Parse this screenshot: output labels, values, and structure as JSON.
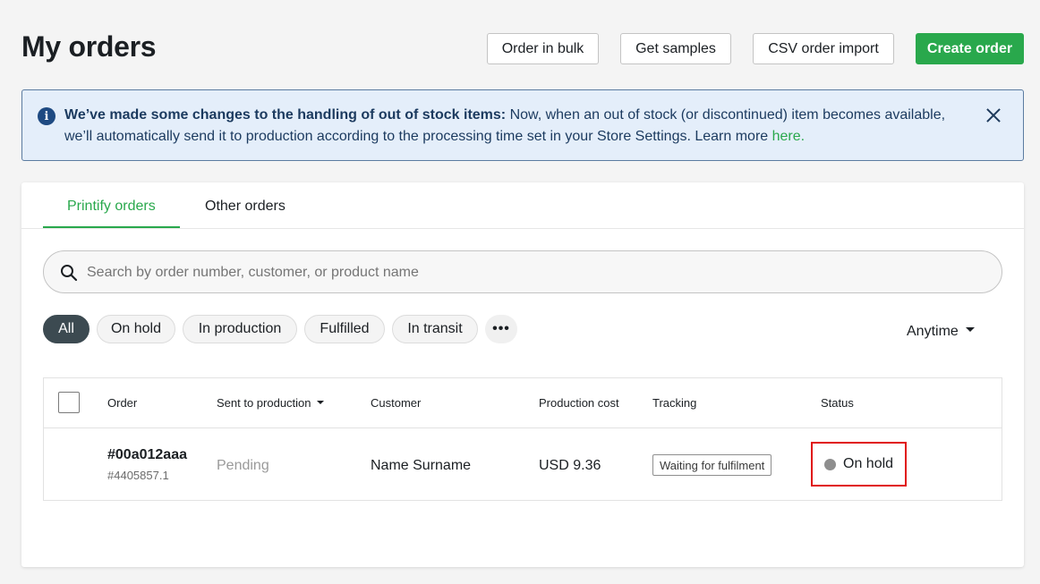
{
  "page": {
    "title": "My orders"
  },
  "toolbar": {
    "order_in_bulk": "Order in bulk",
    "get_samples": "Get samples",
    "csv_import": "CSV order import",
    "create_order": "Create order"
  },
  "banner": {
    "bold_text": "We’ve made some changes to the handling of out of stock items:",
    "text": " Now, when an out of stock (or discontinued) item becomes available, we’ll automatically send it to production according to the processing time set in your Store Settings. Learn more ",
    "link_text": "here.",
    "icon": "info-icon"
  },
  "tabs": [
    {
      "label": "Printify orders",
      "active": true
    },
    {
      "label": "Other orders",
      "active": false
    }
  ],
  "search": {
    "placeholder": "Search by order number, customer, or product name",
    "value": ""
  },
  "filters": {
    "chips": [
      "All",
      "On hold",
      "In production",
      "Fulfilled",
      "In transit"
    ],
    "active": "All",
    "more_label": "•••",
    "date_filter": "Anytime"
  },
  "table": {
    "headers": {
      "order": "Order",
      "sent_to_production": "Sent to production",
      "customer": "Customer",
      "production_cost": "Production cost",
      "tracking": "Tracking",
      "status": "Status"
    },
    "rows": [
      {
        "order_number": "#00a012aaa",
        "order_id": "#4405857.1",
        "sent_to_production": "Pending",
        "customer": "Name Surname",
        "production_cost": "USD 9.36",
        "tracking": "Waiting for fulfilment",
        "status": "On hold"
      }
    ]
  },
  "colors": {
    "accent_green": "#29a84c",
    "banner_bg": "#e4eefa",
    "active_chip": "#3c4a51",
    "highlight_red": "#e01010",
    "status_dot": "#8e8e8e"
  }
}
